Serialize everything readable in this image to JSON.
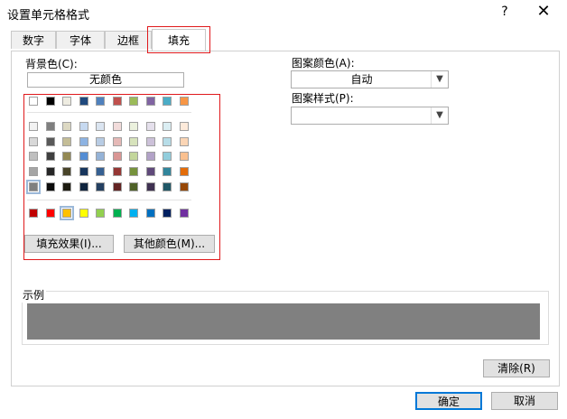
{
  "window": {
    "title": "设置单元格格式",
    "help_label": "?",
    "close_label": "✕"
  },
  "tabs": [
    {
      "label": "数字",
      "active": false
    },
    {
      "label": "字体",
      "active": false
    },
    {
      "label": "边框",
      "active": false
    },
    {
      "label": "填充",
      "active": true
    }
  ],
  "fill": {
    "background_label": "背景色(C):",
    "no_color_label": "无颜色",
    "fill_effects_label": "填充效果(I)...",
    "more_colors_label": "其他颜色(M)...",
    "theme_row": [
      "#ffffff",
      "#000000",
      "#eeece1",
      "#1f497d",
      "#4f81bd",
      "#c0504d",
      "#9bbb59",
      "#8064a2",
      "#4bacc6",
      "#f79646"
    ],
    "tint_rows": [
      [
        "#f2f2f2",
        "#7f7f7f",
        "#ddd9c3",
        "#c6d9f0",
        "#dbe5f1",
        "#f2dcdb",
        "#ebf1dd",
        "#e5e0ec",
        "#dbeef3",
        "#fdeada"
      ],
      [
        "#d8d8d8",
        "#595959",
        "#c4bd97",
        "#8db3e2",
        "#b8cce4",
        "#e5b9b7",
        "#d7e3bc",
        "#ccc1d9",
        "#b7dde8",
        "#fbd5b5"
      ],
      [
        "#bfbfbf",
        "#3f3f3f",
        "#938953",
        "#548dd4",
        "#95b3d7",
        "#d99694",
        "#c3d69b",
        "#b2a2c7",
        "#92cddc",
        "#fac08f"
      ],
      [
        "#a5a5a5",
        "#262626",
        "#494429",
        "#17365d",
        "#366092",
        "#953734",
        "#76923c",
        "#5f497a",
        "#31859b",
        "#e36c09"
      ],
      [
        "#7f7f7f",
        "#0c0c0c",
        "#1d1b10",
        "#0f243e",
        "#244061",
        "#632423",
        "#4f6128",
        "#3f3151",
        "#205867",
        "#974806"
      ]
    ],
    "standard_row": [
      "#c00000",
      "#ff0000",
      "#ffc000",
      "#ffff00",
      "#92d050",
      "#00b050",
      "#00b0f0",
      "#0070c0",
      "#002060",
      "#7030a0"
    ],
    "selected_tint_row": 4,
    "selected_tint_col": 0
  },
  "pattern": {
    "color_label": "图案颜色(A):",
    "color_value": "自动",
    "style_label": "图案样式(P):",
    "style_value": ""
  },
  "sample": {
    "label": "示例",
    "color": "#808080"
  },
  "buttons": {
    "clear_label": "清除(R)",
    "ok_label": "确定",
    "cancel_label": "取消"
  },
  "icons": {
    "dropdown": "chevron-down-icon"
  }
}
